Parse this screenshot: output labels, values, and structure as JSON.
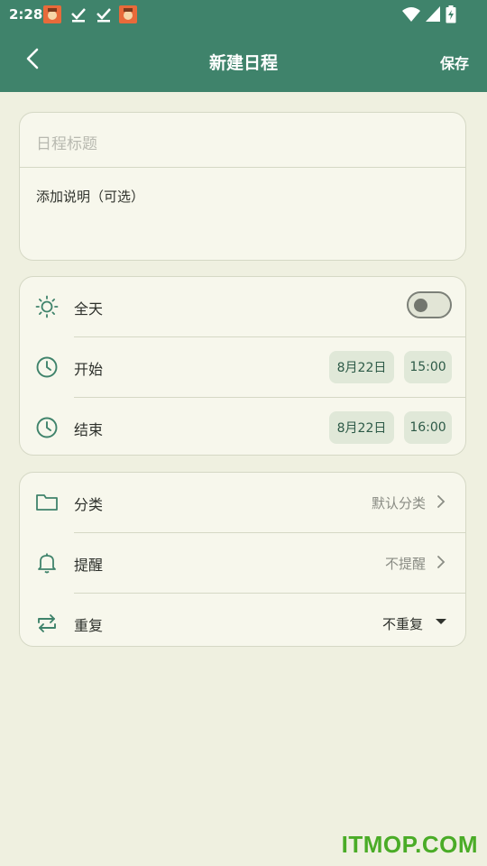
{
  "status_bar": {
    "time": "2:28"
  },
  "app_bar": {
    "title": "新建日程",
    "save_label": "保存"
  },
  "event_card": {
    "title_placeholder": "日程标题",
    "description_placeholder": "添加说明（可选）"
  },
  "time_card": {
    "all_day": {
      "label": "全天",
      "enabled": false
    },
    "start": {
      "label": "开始",
      "date": "8月22日",
      "time": "15:00"
    },
    "end": {
      "label": "结束",
      "date": "8月22日",
      "time": "16:00"
    }
  },
  "options_card": {
    "category": {
      "label": "分类",
      "value": "默认分类"
    },
    "reminder": {
      "label": "提醒",
      "value": "不提醒"
    },
    "repeat": {
      "label": "重复",
      "value": "不重复"
    }
  },
  "watermark": "ITMOP.COM",
  "colors": {
    "primary": "#3f836b",
    "background": "#eff0e0",
    "card": "#f7f7ec"
  }
}
